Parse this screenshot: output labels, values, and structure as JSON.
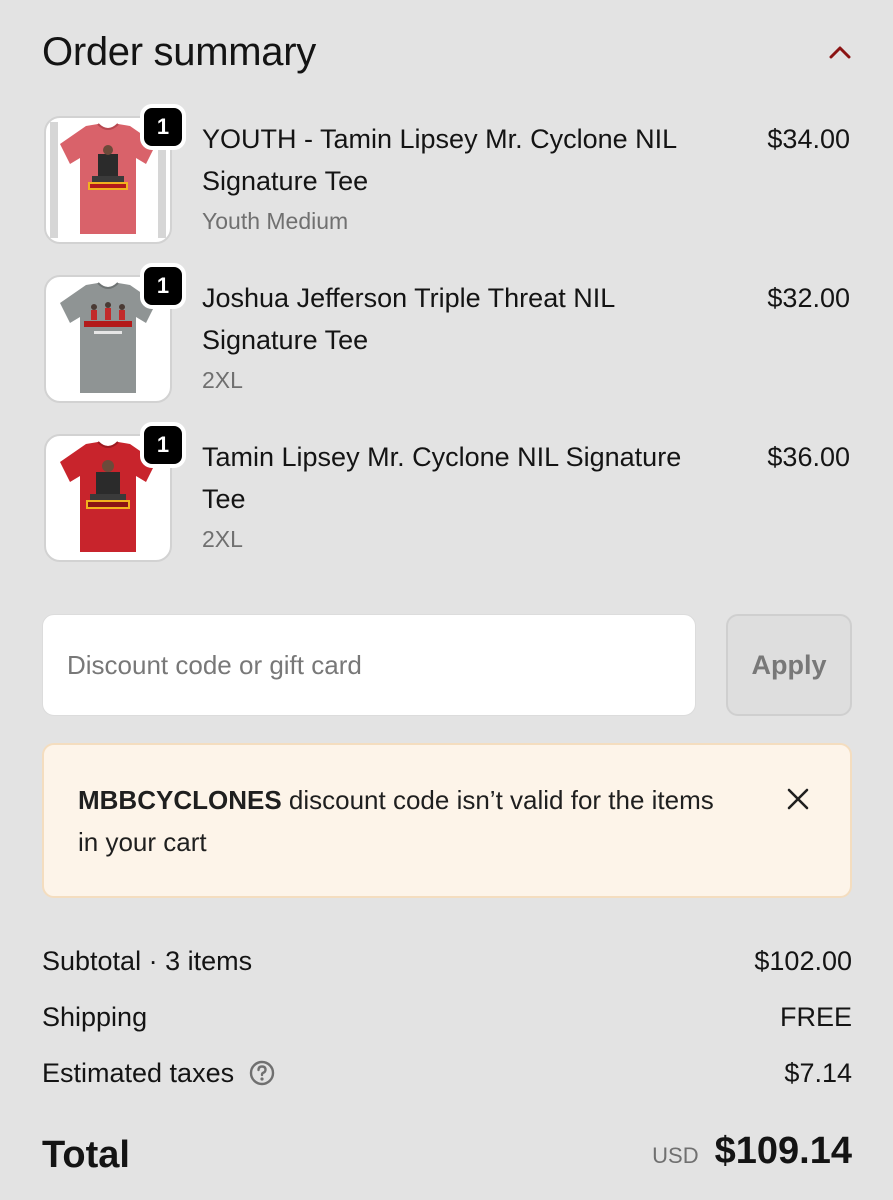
{
  "colors": {
    "background": "#e3e3e3",
    "accent": "#8b1414",
    "alert_bg": "#fdf4e9",
    "alert_border": "#f4ddbf"
  },
  "header": {
    "title": "Order summary",
    "toggle_icon": "chevron-up-icon"
  },
  "items": [
    {
      "quantity": "1",
      "name": "YOUTH - Tamin Lipsey Mr. Cyclone NIL Signature Tee",
      "variant": "Youth Medium",
      "price": "$34.00",
      "image": "red-heather-tshirt"
    },
    {
      "quantity": "1",
      "name": "Joshua Jefferson Triple Threat NIL Signature Tee",
      "variant": "2XL",
      "price": "$32.00",
      "image": "gray-tshirt"
    },
    {
      "quantity": "1",
      "name": "Tamin Lipsey Mr. Cyclone NIL Signature Tee",
      "variant": "2XL",
      "price": "$36.00",
      "image": "red-tshirt"
    }
  ],
  "discount": {
    "placeholder": "Discount code or gift card",
    "value": "",
    "apply_label": "Apply"
  },
  "alert": {
    "code": "MBBCYCLONES",
    "message": " discount code isn’t valid for the items in your cart",
    "close_icon": "close-icon"
  },
  "summary": {
    "subtotal_label": "Subtotal · 3 items",
    "subtotal_value": "$102.00",
    "shipping_label": "Shipping",
    "shipping_value": "FREE",
    "taxes_label": "Estimated taxes",
    "taxes_icon": "help-circle-icon",
    "taxes_value": "$7.14"
  },
  "total": {
    "label": "Total",
    "currency": "USD",
    "value": "$109.14"
  }
}
